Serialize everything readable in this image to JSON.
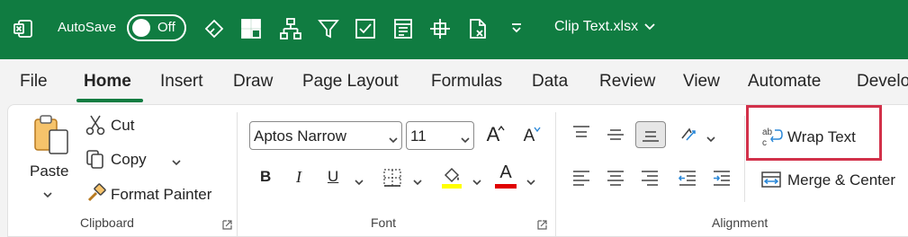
{
  "titlebar": {
    "autosave_label": "AutoSave",
    "autosave_state": "Off",
    "filename": "Clip Text.xlsx",
    "brand_color": "#107c41",
    "quick_access_icons": [
      "excel-logo-icon",
      "eraser-icon",
      "freeze-panes-icon",
      "org-chart-icon",
      "filter-icon",
      "checkbox-icon",
      "form-icon",
      "crosshair-icon",
      "document-icon",
      "customize-icon"
    ]
  },
  "tabs": {
    "items": [
      "File",
      "Home",
      "Insert",
      "Draw",
      "Page Layout",
      "Formulas",
      "Data",
      "Review",
      "View",
      "Automate",
      "Develo"
    ],
    "active": "Home"
  },
  "ribbon": {
    "clipboard": {
      "paste_label": "Paste",
      "cut_label": "Cut",
      "copy_label": "Copy",
      "format_painter_label": "Format Painter",
      "group_label": "Clipboard"
    },
    "font": {
      "font_name": "Aptos Narrow",
      "font_size": "11",
      "bold": "B",
      "italic": "I",
      "underline": "U",
      "grow_font": "A",
      "shrink_font": "A",
      "font_color_glyph": "A",
      "highlight_color": "#ffff00",
      "font_color": "#e00000",
      "group_label": "Font"
    },
    "alignment": {
      "wrap_text_label": "Wrap Text",
      "merge_center_label": "Merge & Center",
      "group_label": "Alignment",
      "highlight_box_color": "#d2314a"
    }
  }
}
